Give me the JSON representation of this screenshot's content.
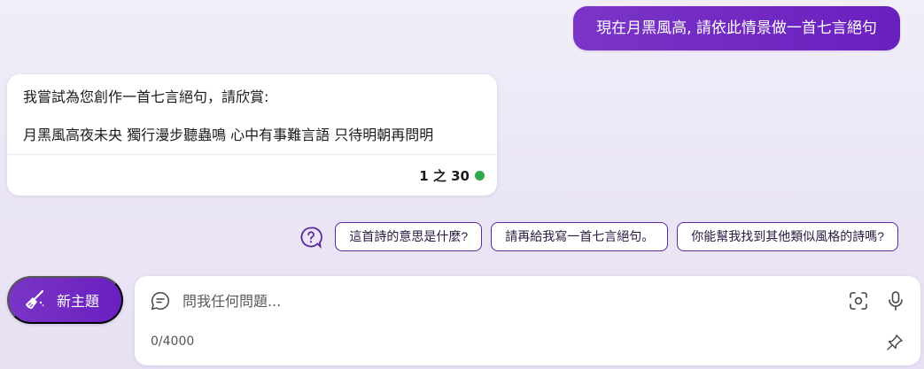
{
  "user_message": {
    "text": "現在月黑風高, 請依此情景做一首七言絕句"
  },
  "bot_message": {
    "intro": "我嘗試為您創作一首七言絕句，請欣賞:",
    "poem": "月黑風高夜未央 獨行漫步聽蟲鳴 心中有事難言語 只待明朝再問明",
    "counter": "1 之 30",
    "status_color": "#2ea84a"
  },
  "suggestions": {
    "icon": "question-circle-icon",
    "items": [
      "這首詩的意思是什麼?",
      "請再給我寫一首七言絕句。",
      "你能幫我找到其他類似風格的詩嗎?"
    ]
  },
  "new_topic": {
    "label": "新主題",
    "icon": "broom-icon"
  },
  "composer": {
    "placeholder": "問我任何問題...",
    "value": "",
    "char_count": "0/4000",
    "icons": [
      "chat-icon",
      "camera-scan-icon",
      "microphone-icon",
      "pin-icon"
    ]
  },
  "colors": {
    "accent": "#6a1fbf",
    "background": "#ece7f6"
  }
}
